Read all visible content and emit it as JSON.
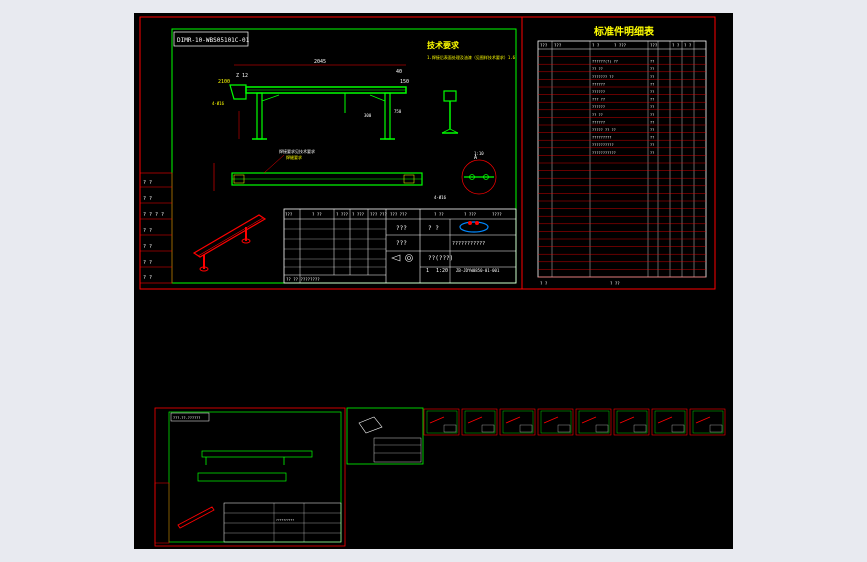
{
  "main_sheet": {
    "drawing_code": "DIMR-10-WBS05101C-01",
    "tech_title": "技术要求",
    "tech_note": "1.焊接后表面处理及油漆（见图样技术要求）1.6",
    "dims": {
      "top_span": "2045",
      "left_a": "Z 12",
      "left_b": "2100",
      "left_c": "80",
      "right_a": "40",
      "right_b": "150",
      "side_note": "4-Ø16",
      "leg_h": "300",
      "leg_h2": "750",
      "detail_label": "A",
      "detail_scale": "1:10",
      "hole_note": "4-Ø16"
    },
    "weld_note": "焊接要求见技术要求",
    "weld_sub": "焊缝要求",
    "title_block": {
      "headers": [
        "???",
        "? ??",
        "? ???",
        "? ???",
        "??? ???",
        "??? ???",
        "? ??",
        "? ???",
        "????"
      ],
      "company": "???",
      "material": "??(???)",
      "part_name": "???????????",
      "qty_a": "???",
      "qty_b": "? ?",
      "scale_a": "1",
      "scale_b": "1:20",
      "code": "ZB-JDYW0850-01-001",
      "footer": "?? ?? ????????"
    },
    "side_table": [
      "? ?",
      "? ?",
      "? ? ? ?",
      "? ?",
      "? ?",
      "? ?",
      "? ?"
    ]
  },
  "parts_list": {
    "title": "标准件明细表",
    "header": [
      "???",
      "???",
      "? ?",
      "? ???",
      "???",
      "? ?",
      "? ?"
    ],
    "rows": [
      {
        "name": "",
        "qty": ""
      },
      {
        "name": "??????(?) ??",
        "qty": "??"
      },
      {
        "name": "?? ??",
        "qty": "??"
      },
      {
        "name": "??????? ??",
        "qty": "??"
      },
      {
        "name": "??????",
        "qty": "??"
      },
      {
        "name": "??????",
        "qty": "??"
      },
      {
        "name": "??? ??",
        "qty": "??"
      },
      {
        "name": "??????",
        "qty": "??"
      },
      {
        "name": "?? ??",
        "qty": "??"
      },
      {
        "name": "??????",
        "qty": "??"
      },
      {
        "name": "????? ?? ??",
        "qty": "??"
      },
      {
        "name": "?????????",
        "qty": "??"
      },
      {
        "name": "??????????",
        "qty": "??"
      },
      {
        "name": "???????????",
        "qty": "??"
      }
    ],
    "footer_a": "? ?",
    "footer_b": "? ??"
  },
  "lower_sheet": {
    "drawing_code": "???-??-??????",
    "title_small": "??????????"
  }
}
